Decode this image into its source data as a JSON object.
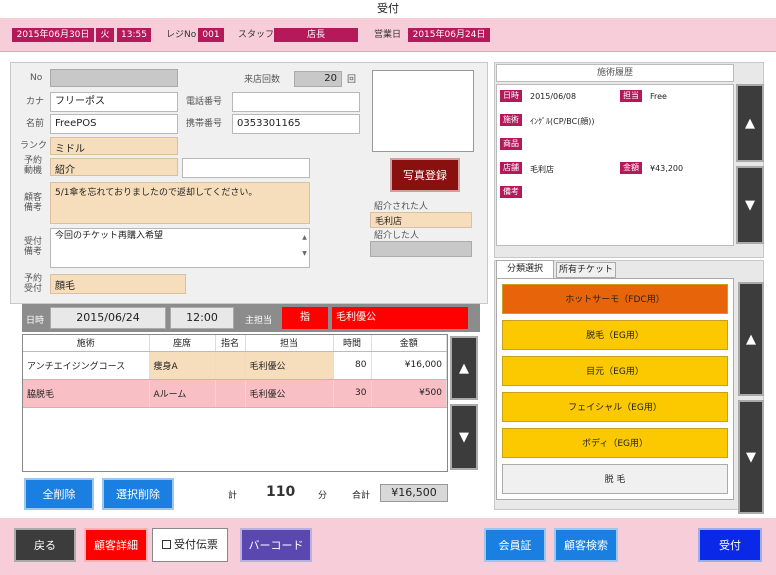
{
  "window": {
    "title": "受付"
  },
  "info_bar": {
    "date": "2015年06月30日",
    "weekday": "火",
    "time": "13:55",
    "register_label": "レジNo",
    "register_no": "001",
    "staff_label": "スタッフ",
    "staff_name": "店長",
    "business_day_label": "営業日",
    "business_day": "2015年06月24日"
  },
  "customer": {
    "no_label": "No",
    "no_value": "",
    "visit_count_label": "来店回数",
    "visit_count": "20",
    "visit_count_unit": "回",
    "kana_label": "カナ",
    "kana_value": "フリーポス",
    "phone_label": "電話番号",
    "phone_value": "",
    "name_label": "名前",
    "name_value": "FreePOS",
    "mobile_label": "携帯番号",
    "mobile_value": "0353301165",
    "rank_label": "ランク",
    "rank_value": "ミドル",
    "reservation_reason_label": "予約\n動機",
    "reservation_reason_value": "紹介",
    "reservation_reason_extra": "",
    "customer_note_label": "顧客\n備考",
    "customer_note_value": "5/1傘を忘れておりましたので返却してください。",
    "reception_note_label": "受付\n備考",
    "reception_note_value": "今回のチケット再購入希望",
    "reservation_reception_label": "予約\n受付",
    "reservation_reception_value": "顔毛",
    "photo_button_label": "写真登録",
    "referred_by_label": "紹介された人",
    "referred_by_value": "毛利店",
    "referred_label": "紹介した人",
    "referred_value": ""
  },
  "schedule": {
    "date_label": "日時",
    "date_value": "2015/06/24",
    "time_value": "12:00",
    "main_staff_label": "主担当",
    "designation_value": "指",
    "main_staff_value": "毛利優公"
  },
  "items_table": {
    "headers": [
      "施術",
      "座席",
      "指名",
      "担当",
      "時間",
      "金額"
    ],
    "rows": [
      [
        "アンチエイジングコース",
        "痩身A",
        "",
        "毛利優公",
        "80",
        "¥16,000"
      ],
      [
        "脇脱毛",
        "Aルーム",
        "",
        "毛利優公",
        "30",
        "¥500"
      ]
    ]
  },
  "totals": {
    "total_label": "計",
    "total_minutes": "110",
    "minutes_unit": "分",
    "sum_label": "合計",
    "sum_value": "¥16,500"
  },
  "table_buttons": {
    "delete_all": "全削除",
    "delete_selected": "選択削除"
  },
  "history": {
    "title": "施術履歴",
    "date_label": "日時",
    "date_value": "2015/06/08",
    "staff_label": "担当",
    "staff_value": "Free",
    "treatment_label": "施術",
    "treatment_value": "ｲﾝｸﾞﾙ(CP/BC(顔))",
    "product_label": "商品",
    "product_value": "",
    "store_label": "店舗",
    "store_value": "毛利店",
    "amount_label": "金額",
    "amount_value": "¥43,200",
    "note_label": "備考",
    "note_value": ""
  },
  "category_tabs": [
    "分類選択",
    "所有チケット"
  ],
  "categories": [
    {
      "label": "ホットサーモ（FDC用）",
      "color": "#e8640a",
      "selected": true
    },
    {
      "label": "脱毛（EG用）",
      "color": "#fcc800",
      "selected": false
    },
    {
      "label": "目元（EG用）",
      "color": "#fcc800",
      "selected": false
    },
    {
      "label": "フェイシャル（EG用）",
      "color": "#fcc800",
      "selected": false
    },
    {
      "label": "ボディ（EG用）",
      "color": "#fcc800",
      "selected": false
    },
    {
      "label": "脱 毛",
      "color": "#f0f0f0",
      "selected": false
    }
  ],
  "bottom_bar": {
    "back": "戻る",
    "customer_detail": "顧客詳細",
    "receipt_slip": "受付伝票",
    "barcode": "バーコード",
    "member_card": "会員証",
    "customer_search": "顧客検索",
    "reception": "受付"
  },
  "arrows": {
    "up": "▲",
    "down": "▼"
  },
  "colors": {
    "accent_magenta": "#b5195a",
    "header_pink": "#f6cdd8",
    "red": "#ff0000",
    "blue_button": "#1a7fe0"
  }
}
